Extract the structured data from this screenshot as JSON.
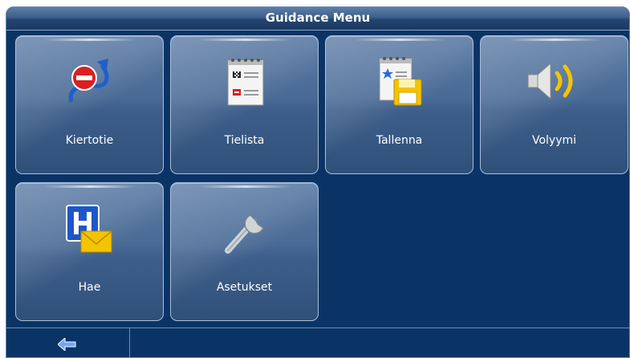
{
  "window": {
    "title": "Guidance Menu"
  },
  "menu": {
    "items": [
      {
        "label": "Kiertotie",
        "icon": "detour-icon"
      },
      {
        "label": "Tielista",
        "icon": "route-list-icon"
      },
      {
        "label": "Tallenna",
        "icon": "save-icon"
      },
      {
        "label": "Volyymi",
        "icon": "volume-icon"
      },
      {
        "label": "Hae",
        "icon": "hospital-search-icon"
      },
      {
        "label": "Asetukset",
        "icon": "wrench-icon"
      }
    ]
  },
  "footer": {
    "back_icon": "back-arrow-icon"
  },
  "colors": {
    "background": "#0b3466",
    "tile": "#4a6b96",
    "accent_yellow": "#f5c400"
  }
}
